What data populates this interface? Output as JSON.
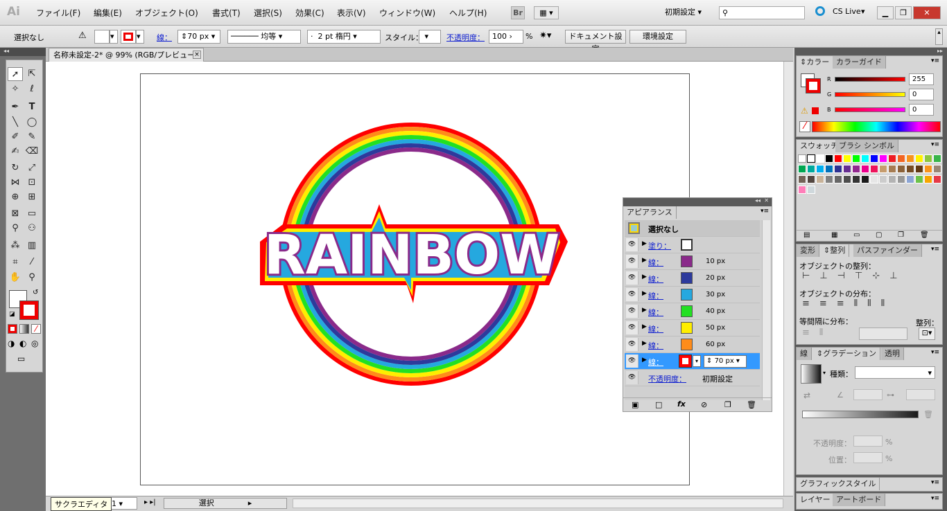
{
  "app": {
    "logo": "Ai",
    "workspace": "初期設定",
    "cs_live": "CS Live",
    "search_placeholder": ""
  },
  "menu": [
    "ファイル(F)",
    "編集(E)",
    "オブジェクト(O)",
    "書式(T)",
    "選択(S)",
    "効果(C)",
    "表示(V)",
    "ウィンドウ(W)",
    "ヘルプ(H)"
  ],
  "bridge": "Br",
  "control": {
    "selection": "選択なし",
    "stroke_label": "線：",
    "stroke_value": "70 px",
    "stroke_profile": "均等",
    "brush": "2 pt 楕円",
    "style_label": "スタイル：",
    "opacity_label": "不透明度：",
    "opacity_value": "100",
    "opacity_unit": "%",
    "doc_setup": "ドキュメント設定",
    "preferences": "環境設定"
  },
  "doc": {
    "tab": "名称未設定-2* @ 99% (RGB/プレビュー)",
    "close": "×"
  },
  "art": {
    "word": "RAINBOW",
    "rings": [
      "#ff0000",
      "#ff8c1a",
      "#ffee00",
      "#22e022",
      "#25a8df",
      "#2d3a9c",
      "#8a2a8a"
    ]
  },
  "appearance": {
    "title": "アピアランス",
    "header": "選択なし",
    "fill_label": "塗り：",
    "stroke_label": "線：",
    "rows": [
      {
        "color": "#8a2a8a",
        "width": "10 px"
      },
      {
        "color": "#2d3a9c",
        "width": "20 px"
      },
      {
        "color": "#25a8df",
        "width": "30 px"
      },
      {
        "color": "#22e022",
        "width": "40 px"
      },
      {
        "color": "#ffee00",
        "width": "50 px"
      },
      {
        "color": "#ff8c1a",
        "width": "60 px"
      }
    ],
    "active": {
      "color": "#ff0000",
      "width": "70 px"
    },
    "opacity_label": "不透明度：",
    "opacity_value": "初期設定"
  },
  "color_panel": {
    "tabs": [
      "カラー",
      "カラーガイド"
    ],
    "r": "255",
    "g": "0",
    "b": "0",
    "r_label": "R",
    "g_label": "G",
    "b_label": "B"
  },
  "swatches": {
    "tabs": [
      "スウォッチ",
      "ブラシ",
      "シンボル"
    ],
    "colors": [
      "#ff0000",
      "#ffff00",
      "#00ff00",
      "#00ffff",
      "#0000ff",
      "#ff00ff",
      "#ed1c24",
      "#f26522",
      "#f7941d",
      "#fff200",
      "#8dc63f",
      "#39b54a",
      "#00a651",
      "#00a99d",
      "#00aeef",
      "#0072bc",
      "#2e3192",
      "#662d91",
      "#92278f",
      "#ec008c",
      "#ed145b",
      "#c69c6d",
      "#a67c52",
      "#8c6239",
      "#754c24",
      "#603913",
      "#f7941d",
      "#998675",
      "#736357",
      "#534741",
      "#c7b299",
      "#808080",
      "#666666",
      "#4d4d4d",
      "#333333",
      "#1a1a1a",
      "#e6e6e6",
      "#cccccc",
      "#b3b3b3",
      "#999999",
      "#8ca5d4",
      "#6cc24a",
      "#f7a600",
      "#e63946",
      "#ff7eb9",
      "#cfd8dc"
    ]
  },
  "align": {
    "tabs": [
      "変形",
      "整列",
      "パスファインダー"
    ],
    "align_objects": "オブジェクトの整列：",
    "distribute_objects": "オブジェクトの分布：",
    "distribute_spacing": "等間隔に分布：",
    "align_to": "整列："
  },
  "gradient": {
    "tabs": [
      "線",
      "グラデーション",
      "透明"
    ],
    "type_label": "種類：",
    "opacity_label": "不透明度：",
    "position_label": "位置：",
    "percent": "%"
  },
  "graphic_styles": {
    "tab": "グラフィックスタイル"
  },
  "layers": {
    "tabs": [
      "レイヤー",
      "アートボード"
    ]
  },
  "status": {
    "tooltip": "サクラエディタ",
    "page": "1",
    "select": "選択"
  }
}
